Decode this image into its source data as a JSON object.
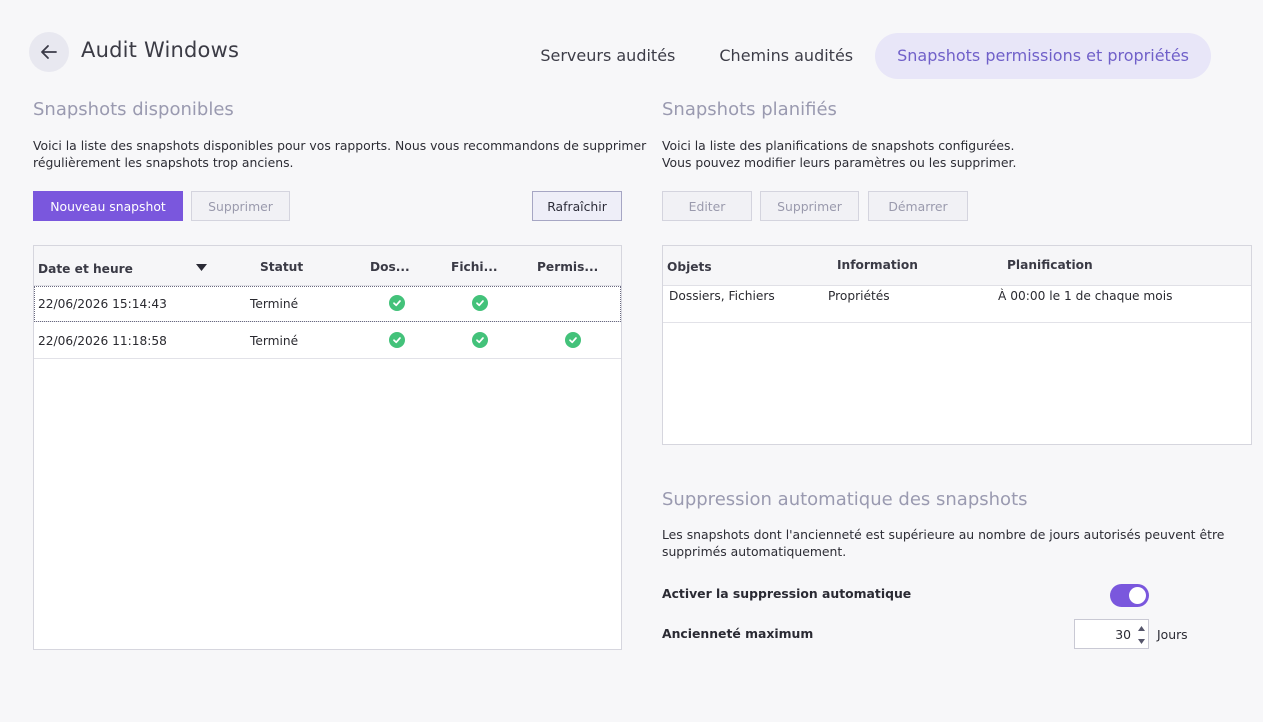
{
  "header": {
    "title": "Audit Windows",
    "tabs": [
      {
        "label": "Serveurs audités"
      },
      {
        "label": "Chemins audités"
      },
      {
        "label": "Snapshots permissions et propriétés"
      }
    ]
  },
  "left": {
    "title": "Snapshots disponibles",
    "desc_line1": "Voici la liste des snapshots disponibles pour vos rapports. Nous vous recommandons de supprimer",
    "desc_line2": "régulièrement les snapshots trop anciens.",
    "buttons": {
      "new": "Nouveau snapshot",
      "delete": "Supprimer",
      "refresh": "Rafraîchir"
    },
    "columns": {
      "date": "Date et heure",
      "status": "Statut",
      "folders": "Dos...",
      "files": "Fichi...",
      "perms": "Permis..."
    },
    "rows": [
      {
        "date": "22/06/2026 15:14:43",
        "status": "Terminé",
        "folders": true,
        "files": true,
        "perms": false
      },
      {
        "date": "22/06/2026 11:18:58",
        "status": "Terminé",
        "folders": true,
        "files": true,
        "perms": true
      }
    ]
  },
  "right": {
    "title": "Snapshots planifiés",
    "desc_line1": "Voici la liste des planifications de snapshots configurées.",
    "desc_line2": "Vous pouvez modifier leurs paramètres ou les supprimer.",
    "buttons": {
      "edit": "Editer",
      "delete": "Supprimer",
      "start": "Démarrer"
    },
    "columns": {
      "objects": "Objets",
      "info": "Information",
      "schedule": "Planification"
    },
    "rows": [
      {
        "objects": "Dossiers, Fichiers",
        "info": "Propriétés",
        "schedule": "À 00:00 le 1 de chaque mois"
      }
    ]
  },
  "auto_delete": {
    "title": "Suppression automatique des snapshots",
    "desc_line1": "Les snapshots dont l'ancienneté est supérieure au nombre de jours autorisés peuvent être",
    "desc_line2": "supprimés automatiquement.",
    "enable_label": "Activer la suppression automatique",
    "enabled": true,
    "max_age_label": "Ancienneté maximum",
    "max_age_value": "30",
    "max_age_unit": "Jours"
  },
  "colors": {
    "accent": "#7a57dd",
    "success": "#43c27a",
    "tab_active_bg": "#e8e6f8"
  }
}
